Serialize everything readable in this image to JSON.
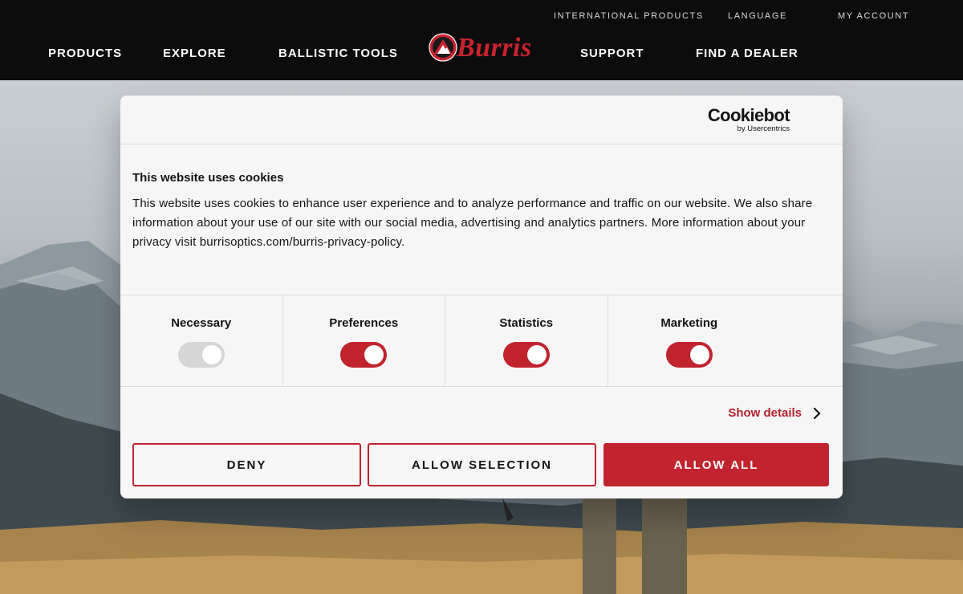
{
  "header": {
    "utility_links": [
      "INTERNATIONAL PRODUCTS",
      "LANGUAGE",
      "MY ACCOUNT"
    ],
    "nav_left": [
      "PRODUCTS",
      "EXPLORE",
      "BALLISTIC TOOLS"
    ],
    "nav_right": [
      "SUPPORT",
      "FIND A DEALER"
    ],
    "logo_text": "Burris",
    "brand_color": "#c8232f"
  },
  "cookie_dialog": {
    "provider_logo": "Cookiebot",
    "provider_sub": "by Usercentrics",
    "title": "This website uses cookies",
    "text": "This website uses cookies to enhance user experience and to analyze performance and traffic on our website. We also share information about your use of our site with our social media, advertising and analytics partners. More information about your privacy visit burrisoptics.com/burris-privacy-policy.",
    "categories": [
      {
        "label": "Necessary",
        "enabled": true,
        "locked": true
      },
      {
        "label": "Preferences",
        "enabled": true,
        "locked": false
      },
      {
        "label": "Statistics",
        "enabled": true,
        "locked": false
      },
      {
        "label": "Marketing",
        "enabled": true,
        "locked": false
      }
    ],
    "show_details": "Show details",
    "buttons": {
      "deny": "DENY",
      "allow_selection": "ALLOW SELECTION",
      "allow_all": "ALLOW ALL"
    },
    "accent_color": "#c1232f"
  },
  "icons": [
    "burris-logo-icon",
    "chevron-right-icon"
  ]
}
